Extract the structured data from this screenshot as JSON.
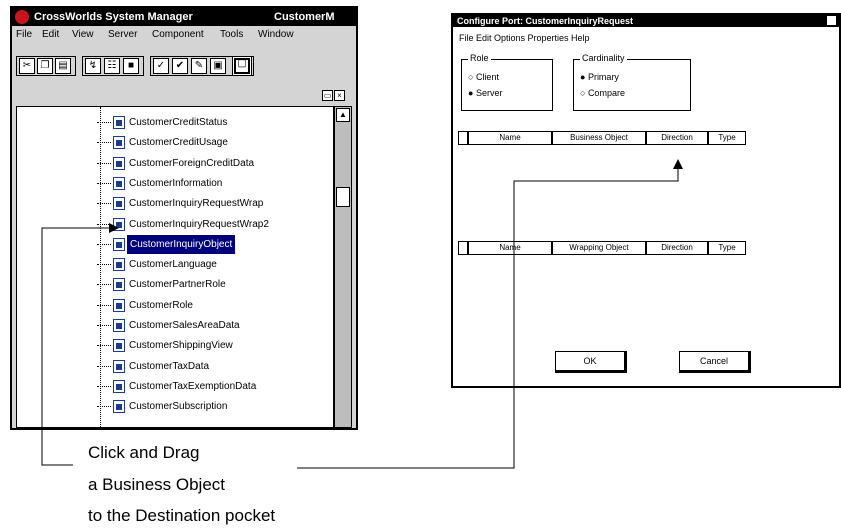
{
  "left_window": {
    "title": "CrossWorlds System Manager",
    "title_right": "CustomerM",
    "menu": [
      "File",
      "Edit",
      "View",
      "Server",
      "Component",
      "Tools",
      "Window"
    ],
    "tree_items": [
      "CustomerCreditStatus",
      "CustomerCreditUsage",
      "CustomerForeignCreditData",
      "CustomerInformation",
      "CustomerInquiryRequestWrap",
      "CustomerInquiryRequestWrap2",
      "CustomerInquiryObject",
      "CustomerLanguage",
      "CustomerPartnerRole",
      "CustomerRole",
      "CustomerSalesAreaData",
      "CustomerShippingView",
      "CustomerTaxData",
      "CustomerTaxExemptionData",
      "CustomerSubscription"
    ],
    "selected_index": 6
  },
  "right_window": {
    "title": "Configure Port: CustomerInquiryRequest",
    "menu": "File   Edit   Options   Properties   Help",
    "group_role": {
      "caption": "Role",
      "options": [
        "Client",
        "Server"
      ],
      "checked": "Server"
    },
    "group_cardinality": {
      "caption": "Cardinality",
      "options": [
        "Primary",
        "Compare"
      ]
    },
    "table1_headers": [
      "",
      "Name",
      "Business Object",
      "Direction",
      "Type"
    ],
    "table2_headers": [
      "",
      "Name",
      "Wrapping Object",
      "Direction",
      "Type"
    ],
    "ok_label": "OK",
    "cancel_label": "Cancel"
  },
  "annotation": {
    "lines": [
      "Click and Drag",
      "a Business Object",
      "to the Destination pocket"
    ]
  }
}
